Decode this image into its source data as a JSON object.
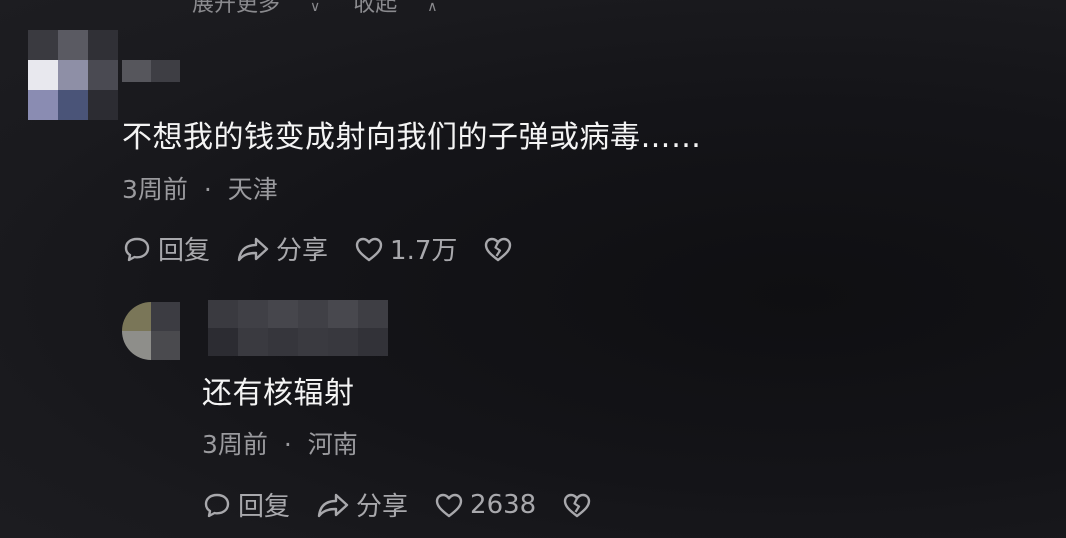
{
  "top_row": {
    "expand_label": "展开更多",
    "collapse_label": "收起"
  },
  "comments": [
    {
      "text": "不想我的钱变成射向我们的子弹或病毒……",
      "time": "3周前",
      "separator": "·",
      "location": "天津",
      "reply_label": "回复",
      "share_label": "分享",
      "like_count": "1.7万"
    },
    {
      "text": "还有核辐射",
      "time": "3周前",
      "separator": "·",
      "location": "河南",
      "reply_label": "回复",
      "share_label": "分享",
      "like_count": "2638"
    }
  ],
  "icons": {
    "expand": "chevron-down-icon",
    "collapse": "chevron-up-icon",
    "reply": "comment-bubble-icon",
    "share": "share-arrow-icon",
    "like": "heart-icon",
    "dislike": "broken-heart-icon"
  },
  "colors": {
    "background": "#141418",
    "primary_text": "#f4f4f4",
    "meta_text": "#9a9a9e",
    "action_text": "#a8a8ac"
  }
}
